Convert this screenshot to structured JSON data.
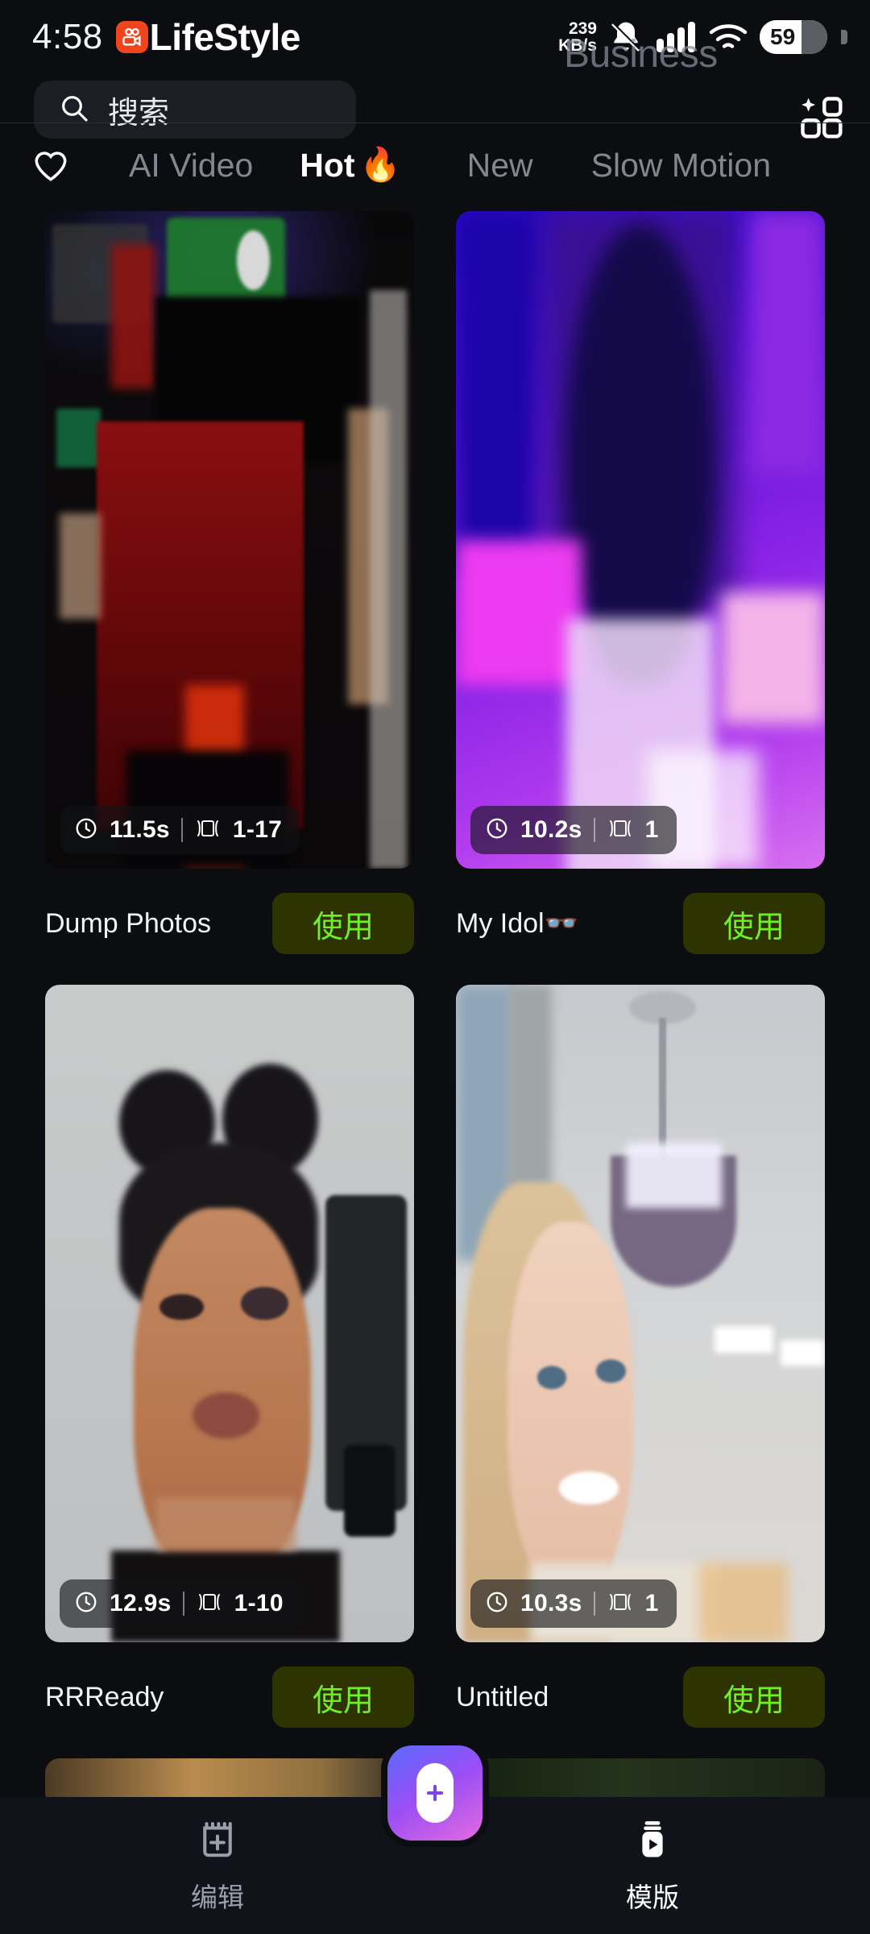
{
  "status_bar": {
    "time": "4:58",
    "app_name": "LifeStyle",
    "network_speed_value": "239",
    "network_speed_unit": "KB/s",
    "battery_percent": "59",
    "watermark": "Business",
    "icons": [
      "app-logo-icon",
      "bell-muted-icon",
      "signal-bars-icon",
      "wifi-icon",
      "battery-icon"
    ]
  },
  "search": {
    "placeholder": "搜索",
    "icon": "search-icon"
  },
  "tabs": {
    "favorite_icon": "heart-icon",
    "ai_templates_icon": "sparkle-grid-icon",
    "items": [
      {
        "label": "AI Video",
        "active": false
      },
      {
        "label": "Hot",
        "emoji": "🔥",
        "active": true
      },
      {
        "label": "New",
        "active": false
      },
      {
        "label": "Slow Motion",
        "active": false
      }
    ]
  },
  "templates": [
    {
      "title": "Dump Photos",
      "duration": "11.5s",
      "clips": "1-17",
      "use_label": "使用",
      "thumb_style": "red-club-scene"
    },
    {
      "title": "My Idol👓",
      "duration": "10.2s",
      "clips": "1",
      "use_label": "使用",
      "thumb_style": "purple-stage-scene"
    },
    {
      "title": "RRReady",
      "duration": "12.9s",
      "clips": "1-10",
      "use_label": "使用",
      "thumb_style": "grey-selfie-scene"
    },
    {
      "title": "Untitled",
      "duration": "10.3s",
      "clips": "1",
      "use_label": "使用",
      "thumb_style": "bright-chandelier-scene"
    }
  ],
  "badge_icons": {
    "clock": "clock-icon",
    "clip": "clip-frames-icon"
  },
  "bottom_nav": {
    "items": [
      {
        "label": "编辑",
        "icon": "clapperboard-plus-icon",
        "active": false
      },
      {
        "label": "模版",
        "icon": "template-play-icon",
        "active": true
      }
    ],
    "create_button": {
      "icon": "plus-icon",
      "gradient_from": "#5b6bff",
      "gradient_to": "#e46ae0"
    }
  },
  "colors": {
    "background": "#0b0d11",
    "nav_background": "#101319",
    "use_button_bg": "#2e3302",
    "use_button_text": "#6ff02a",
    "tab_inactive": "#83878f",
    "tab_active": "#ffffff",
    "app_logo": "#f0441f"
  }
}
